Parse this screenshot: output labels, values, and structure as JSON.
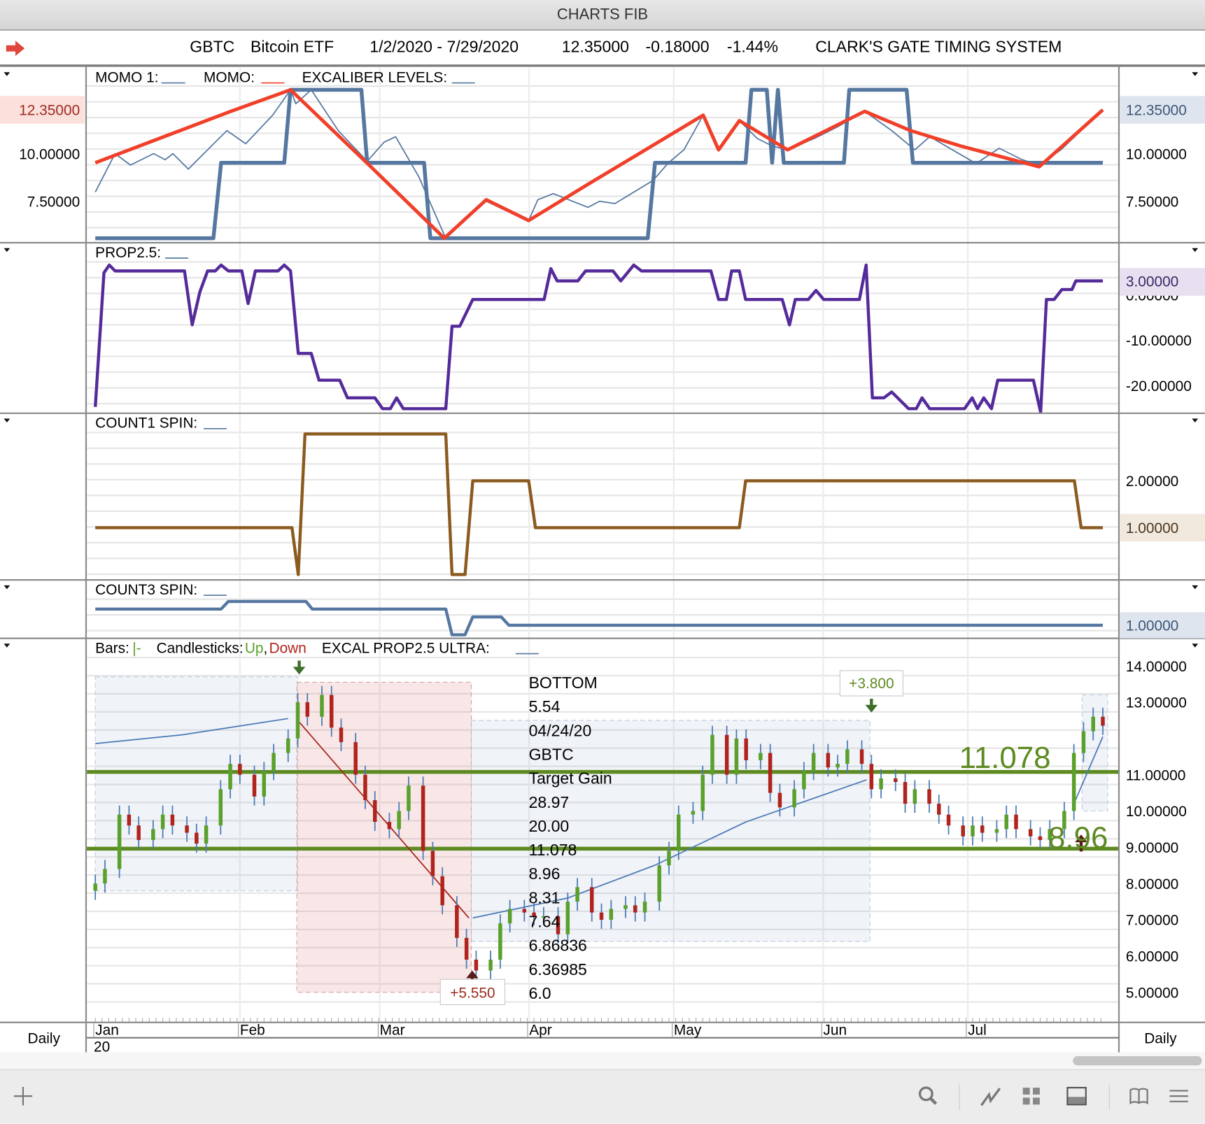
{
  "window": {
    "title": "CHARTS FIB"
  },
  "info": {
    "symbol": "GBTC",
    "name": "Bitcoin ETF",
    "range": "1/2/2020 - 7/29/2020",
    "last": "12.35000",
    "change": "-0.18000",
    "pct": "-1.44%",
    "system": "CLARK'S GATE TIMING SYSTEM"
  },
  "colors": {
    "momo1": "#5577a0",
    "momo": "#f0402a",
    "prop": "#552a9a",
    "count1": "#8b5a1e",
    "count3": "#5577a0",
    "up": "#5aa02c",
    "down": "#b0241e",
    "level": "#5e8a22"
  },
  "panels": {
    "momo": {
      "legend": [
        "MOMO 1:",
        "MOMO:",
        "EXCALIBER LEVELS:"
      ],
      "left_last": "12.35000",
      "right_last": "12.35000",
      "ticks": [
        "10.00000",
        "7.50000"
      ],
      "tick_values": [
        10,
        7.5
      ],
      "right_ticks": [
        "10.00000",
        "7.50000"
      ]
    },
    "prop": {
      "legend": "PROP2.5:",
      "last": "3.00000",
      "ticks": [
        "0.00000",
        "-10.00000",
        "-20.00000"
      ],
      "tick_values": [
        0,
        -10,
        -20
      ]
    },
    "count1": {
      "legend": "COUNT1 SPIN:",
      "last": "1.00000",
      "ticks": [
        "2.00000"
      ],
      "tick_values": [
        2
      ]
    },
    "count3": {
      "legend": "COUNT3 SPIN:",
      "last": "1.00000"
    },
    "price": {
      "legend_bars": "Bars:",
      "legend_bars_sym": "|-",
      "legend_candles": "Candlesticks:",
      "legend_up": "Up",
      "legend_comma": ",",
      "legend_down": "Down",
      "legend_excal": "EXCAL PROP2.5 ULTRA:",
      "last": "12.35000",
      "ticks": [
        "14.00000",
        "13.00000",
        "11.00000",
        "10.00000",
        "9.00000",
        "8.00000",
        "7.00000",
        "6.00000",
        "5.00000"
      ],
      "tick_values": [
        14,
        13,
        11,
        10,
        9,
        8,
        7,
        6,
        5
      ],
      "fib_list": [
        "BOTTOM",
        "5.54",
        "04/24/20",
        "GBTC",
        "Target Gain",
        "28.97",
        "20.00",
        "11.078",
        "8.96",
        "8.31",
        "7.64",
        "6.86836",
        "6.36985",
        "6.0"
      ],
      "level_high": {
        "value": 11.078,
        "label": "11.078"
      },
      "level_low": {
        "value": 8.96,
        "label": "8.96"
      },
      "gain_up": "+3.800",
      "gain_low": "+5.550"
    }
  },
  "axis": {
    "months": [
      "Jan",
      "Feb",
      "Mar",
      "Apr",
      "May",
      "Jun",
      "Jul"
    ],
    "month_days": [
      2,
      32,
      61,
      92,
      122,
      153,
      183
    ],
    "year": "20",
    "left_period": "Daily",
    "right_period": "Daily"
  },
  "chart_data": {
    "type": "line",
    "x_unit": "day of year 2020",
    "xlim": [
      2,
      211
    ],
    "momo1": [
      [
        2,
        7.98
      ],
      [
        6.1,
        10
      ],
      [
        9.3,
        9.4
      ],
      [
        14.1,
        10
      ],
      [
        16.5,
        9.68
      ],
      [
        18.1,
        10
      ],
      [
        21.3,
        9.19
      ],
      [
        29.3,
        11.21
      ],
      [
        33.2,
        10.52
      ],
      [
        38.8,
        12.02
      ],
      [
        42.5,
        13.35
      ],
      [
        43.6,
        12.62
      ],
      [
        46.8,
        13.35
      ],
      [
        52.4,
        11.21
      ],
      [
        58.4,
        9.6
      ],
      [
        61.9,
        10.6
      ],
      [
        64.3,
        10.89
      ],
      [
        69.1,
        8.79
      ],
      [
        74.7,
        5.56
      ],
      [
        77.9,
        6.37
      ],
      [
        83.1,
        7.5
      ],
      [
        87.4,
        6.98
      ],
      [
        91.9,
        6.49
      ],
      [
        93.8,
        7.58
      ],
      [
        97,
        7.9
      ],
      [
        100.2,
        7.58
      ],
      [
        104.2,
        7.18
      ],
      [
        106.6,
        7.5
      ],
      [
        109.8,
        7.38
      ],
      [
        117.7,
        8.59
      ],
      [
        120.9,
        9.52
      ],
      [
        124.1,
        10.2
      ],
      [
        128.1,
        12.02
      ],
      [
        131.3,
        10.2
      ],
      [
        135.6,
        11.73
      ],
      [
        139.3,
        10.8
      ],
      [
        142.4,
        10.4
      ],
      [
        145.6,
        10.2
      ],
      [
        151.2,
        10.8
      ],
      [
        156,
        11.41
      ],
      [
        161.6,
        12.22
      ],
      [
        167.2,
        11.21
      ],
      [
        172,
        10.2
      ],
      [
        175.1,
        10.89
      ],
      [
        184.7,
        9.48
      ],
      [
        189.5,
        10.28
      ],
      [
        194.3,
        9.68
      ],
      [
        197.8,
        9.4
      ],
      [
        202.3,
        10.2
      ],
      [
        211,
        12.3
      ]
    ],
    "momo": [
      [
        2,
        9.52
      ],
      [
        30.1,
        12.22
      ],
      [
        42.5,
        13.35
      ],
      [
        58.8,
        9.4
      ],
      [
        74.4,
        5.56
      ],
      [
        83.1,
        7.58
      ],
      [
        91.9,
        6.49
      ],
      [
        104.2,
        8.39
      ],
      [
        128.1,
        12.02
      ],
      [
        131.3,
        10.2
      ],
      [
        135.6,
        11.73
      ],
      [
        145.6,
        10.2
      ],
      [
        161.6,
        12.22
      ],
      [
        171.1,
        11.21
      ],
      [
        181.5,
        10.4
      ],
      [
        197.8,
        9.31
      ],
      [
        211,
        12.3
      ]
    ],
    "excaliber_levels": [
      [
        2,
        5.56
      ],
      [
        26.5,
        5.56
      ],
      [
        28.1,
        9.52
      ],
      [
        41.2,
        9.52
      ],
      [
        42.5,
        13.35
      ],
      [
        57.2,
        13.35
      ],
      [
        58.4,
        9.52
      ],
      [
        70.2,
        9.52
      ],
      [
        71.5,
        5.56
      ],
      [
        116.6,
        5.56
      ],
      [
        118.1,
        9.52
      ],
      [
        136.9,
        9.52
      ],
      [
        138.1,
        13.35
      ],
      [
        141.3,
        13.35
      ],
      [
        142.4,
        9.52
      ],
      [
        143.6,
        13.35
      ],
      [
        144.8,
        9.52
      ],
      [
        157.3,
        9.52
      ],
      [
        158.4,
        13.35
      ],
      [
        170.3,
        13.35
      ],
      [
        171.6,
        9.52
      ],
      [
        211,
        9.52
      ]
    ],
    "prop25": [
      [
        2,
        -24.7
      ],
      [
        3.8,
        4.9
      ],
      [
        4.9,
        6.6
      ],
      [
        6.1,
        5.3
      ],
      [
        20.5,
        5.3
      ],
      [
        22.1,
        -6.6
      ],
      [
        23.7,
        0.7
      ],
      [
        25.3,
        5.3
      ],
      [
        26.9,
        5.3
      ],
      [
        28.1,
        6.6
      ],
      [
        29.6,
        5.3
      ],
      [
        32.4,
        5.3
      ],
      [
        33.7,
        -1.9
      ],
      [
        35.2,
        5.3
      ],
      [
        39.9,
        5.3
      ],
      [
        41.2,
        6.6
      ],
      [
        42.5,
        5.3
      ],
      [
        44.1,
        -12.9
      ],
      [
        46.8,
        -12.9
      ],
      [
        48.4,
        -18.8
      ],
      [
        52.7,
        -18.8
      ],
      [
        54.3,
        -22.7
      ],
      [
        60,
        -22.7
      ],
      [
        61.6,
        -25.1
      ],
      [
        63.2,
        -25.1
      ],
      [
        64.5,
        -22.7
      ],
      [
        65.9,
        -25.1
      ],
      [
        74.7,
        -25.1
      ],
      [
        76,
        -6.9
      ],
      [
        77.6,
        -6.9
      ],
      [
        80.3,
        -1
      ],
      [
        95.1,
        -1
      ],
      [
        96.5,
        5.8
      ],
      [
        97.8,
        3.1
      ],
      [
        102.1,
        3.1
      ],
      [
        103.7,
        5.3
      ],
      [
        109.4,
        5.3
      ],
      [
        111,
        3.1
      ],
      [
        113.7,
        6.6
      ],
      [
        115.3,
        5.3
      ],
      [
        129.7,
        5.3
      ],
      [
        131.3,
        -1
      ],
      [
        132.9,
        -1
      ],
      [
        134,
        5.3
      ],
      [
        135.6,
        5.3
      ],
      [
        136.9,
        -1
      ],
      [
        144.5,
        -1
      ],
      [
        146,
        -6.6
      ],
      [
        147.2,
        -1
      ],
      [
        149.9,
        -1
      ],
      [
        151.5,
        1
      ],
      [
        153.1,
        -1
      ],
      [
        160.5,
        -1
      ],
      [
        161.9,
        6.6
      ],
      [
        163.2,
        -22.7
      ],
      [
        165.6,
        -22.7
      ],
      [
        167.2,
        -21.4
      ],
      [
        170.7,
        -25.1
      ],
      [
        172.3,
        -25.1
      ],
      [
        173.5,
        -22.7
      ],
      [
        175.1,
        -25.1
      ],
      [
        182.3,
        -25.1
      ],
      [
        183.9,
        -22.7
      ],
      [
        185,
        -25.1
      ],
      [
        186.3,
        -22.7
      ],
      [
        187.9,
        -25.1
      ],
      [
        189.2,
        -18.8
      ],
      [
        196.6,
        -18.8
      ],
      [
        198.1,
        -25.9
      ],
      [
        199.3,
        -1
      ],
      [
        200.9,
        -1
      ],
      [
        202.5,
        1.2
      ],
      [
        204.6,
        1.2
      ],
      [
        205.4,
        3.1
      ],
      [
        211,
        3.1
      ]
    ],
    "count1": [
      [
        2,
        1
      ],
      [
        42.8,
        1
      ],
      [
        44.1,
        0
      ],
      [
        45.5,
        3
      ],
      [
        74.7,
        3
      ],
      [
        76,
        0
      ],
      [
        78.7,
        0
      ],
      [
        80.3,
        2
      ],
      [
        91.9,
        2
      ],
      [
        93.3,
        1
      ],
      [
        135.6,
        1
      ],
      [
        136.9,
        2
      ],
      [
        205.1,
        2
      ],
      [
        206.5,
        1
      ],
      [
        211,
        1
      ]
    ],
    "count3": [
      [
        2,
        1.68
      ],
      [
        28.1,
        1.68
      ],
      [
        29.6,
        2
      ],
      [
        45.7,
        2
      ],
      [
        47,
        1.68
      ],
      [
        74.7,
        1.68
      ],
      [
        76,
        0.6
      ],
      [
        78.7,
        0.6
      ],
      [
        80.3,
        1.35
      ],
      [
        86.2,
        1.35
      ],
      [
        87.8,
        1
      ],
      [
        211,
        1
      ]
    ],
    "price_closes": [
      [
        2,
        8.0
      ],
      [
        4,
        8.4
      ],
      [
        7,
        9.9
      ],
      [
        9,
        9.6
      ],
      [
        11,
        9.2
      ],
      [
        14,
        9.5
      ],
      [
        16,
        9.9
      ],
      [
        18,
        9.6
      ],
      [
        21,
        9.4
      ],
      [
        23,
        9.1
      ],
      [
        25,
        9.6
      ],
      [
        28,
        10.6
      ],
      [
        30,
        11.3
      ],
      [
        32,
        11.0
      ],
      [
        35,
        10.4
      ],
      [
        37,
        11.1
      ],
      [
        39,
        11.6
      ],
      [
        42,
        12.0
      ],
      [
        44,
        13.0
      ],
      [
        46,
        12.6
      ],
      [
        49,
        13.2
      ],
      [
        51,
        12.3
      ],
      [
        53,
        11.9
      ],
      [
        56,
        11.0
      ],
      [
        58,
        10.3
      ],
      [
        60,
        9.7
      ],
      [
        63,
        9.5
      ],
      [
        65,
        10.0
      ],
      [
        67,
        10.7
      ],
      [
        70,
        8.9
      ],
      [
        72,
        8.2
      ],
      [
        74,
        7.4
      ],
      [
        77,
        6.5
      ],
      [
        79,
        5.9
      ],
      [
        81,
        5.6
      ],
      [
        84,
        5.9
      ],
      [
        86,
        6.9
      ],
      [
        88,
        7.3
      ],
      [
        91,
        7.2
      ],
      [
        93,
        7.1
      ],
      [
        95,
        7.1
      ],
      [
        98,
        6.6
      ],
      [
        100,
        7.5
      ],
      [
        102,
        7.9
      ],
      [
        105,
        7.2
      ],
      [
        107,
        7.0
      ],
      [
        109,
        7.3
      ],
      [
        112,
        7.4
      ],
      [
        114,
        7.2
      ],
      [
        116,
        7.5
      ],
      [
        119,
        8.5
      ],
      [
        121,
        8.9
      ],
      [
        123,
        9.9
      ],
      [
        126,
        10.0
      ],
      [
        128,
        11.0
      ],
      [
        130,
        12.1
      ],
      [
        133,
        11.0
      ],
      [
        135,
        12.0
      ],
      [
        137,
        11.4
      ],
      [
        140,
        11.6
      ],
      [
        142,
        10.5
      ],
      [
        144,
        10.1
      ],
      [
        147,
        10.6
      ],
      [
        149,
        11.1
      ],
      [
        151,
        11.6
      ],
      [
        154,
        11.2
      ],
      [
        156,
        11.3
      ],
      [
        158,
        11.7
      ],
      [
        161,
        11.3
      ],
      [
        163,
        10.6
      ],
      [
        165,
        10.9
      ],
      [
        168,
        10.8
      ],
      [
        170,
        10.2
      ],
      [
        172,
        10.6
      ],
      [
        175,
        10.2
      ],
      [
        177,
        9.9
      ],
      [
        179,
        9.6
      ],
      [
        182,
        9.3
      ],
      [
        184,
        9.6
      ],
      [
        186,
        9.4
      ],
      [
        189,
        9.5
      ],
      [
        191,
        9.9
      ],
      [
        193,
        9.5
      ],
      [
        196,
        9.3
      ],
      [
        198,
        9.2
      ],
      [
        200,
        9.5
      ],
      [
        203,
        10.0
      ],
      [
        205,
        11.6
      ],
      [
        207,
        12.2
      ],
      [
        209,
        12.6
      ],
      [
        211,
        12.35
      ]
    ],
    "moving_avg": [
      [
        [
          2,
          11.86
        ],
        [
          20,
          12.1
        ],
        [
          42,
          12.55
        ]
      ],
      [
        [
          80.3,
          7.05
        ],
        [
          100,
          7.6
        ],
        [
          118,
          8.5
        ],
        [
          137,
          9.7
        ],
        [
          162,
          10.86
        ]
      ],
      [
        [
          205,
          10.2
        ],
        [
          211,
          12.05
        ]
      ]
    ],
    "trend_line": [
      [
        44,
        12.5
      ],
      [
        79.5,
        7.05
      ]
    ],
    "zones": [
      {
        "from": 2,
        "to": 44,
        "low": 7.8,
        "high": 13.7,
        "kind": "blue"
      },
      {
        "from": 43.8,
        "to": 80,
        "low": 5.0,
        "high": 13.55,
        "kind": "red"
      },
      {
        "from": 80,
        "to": 162.7,
        "low": 6.4,
        "high": 12.5,
        "kind": "blue"
      },
      {
        "from": 206.7,
        "to": 212,
        "low": 10.0,
        "high": 13.2,
        "kind": "blue"
      }
    ],
    "markers": [
      {
        "day": 44.3,
        "value": 13.85,
        "dir": "down"
      },
      {
        "day": 163,
        "value": 12.8,
        "dir": "down"
      },
      {
        "day": 80.2,
        "value": 5.6,
        "dir": "up"
      },
      {
        "day": 206.5,
        "value": 9.35,
        "dir": "up"
      }
    ],
    "ylim_price": [
      5,
      14
    ]
  }
}
